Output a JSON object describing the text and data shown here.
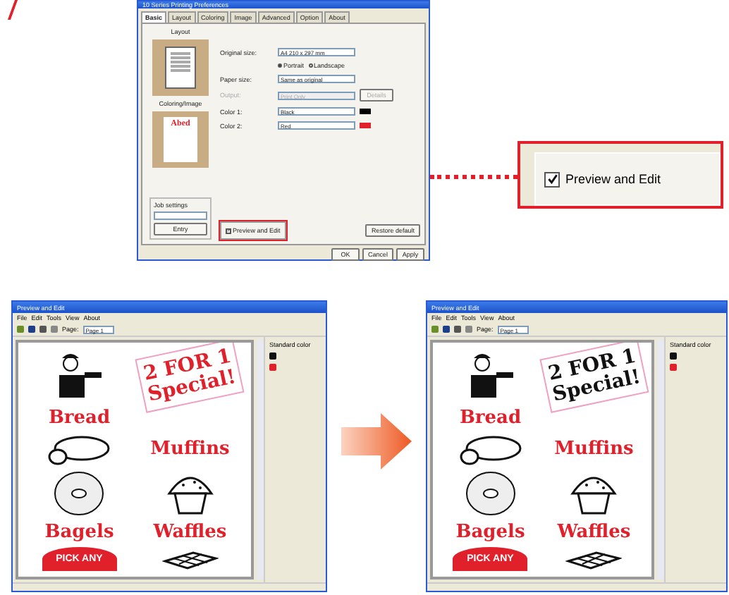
{
  "settings_dialog": {
    "title": "10 Series Printing Preferences",
    "tabs": [
      {
        "label": "Basic",
        "selected": true
      },
      {
        "label": "Layout",
        "selected": false
      },
      {
        "label": "Coloring",
        "selected": false
      },
      {
        "label": "Image",
        "selected": false
      },
      {
        "label": "Advanced",
        "selected": false
      },
      {
        "label": "Option",
        "selected": false
      },
      {
        "label": "About",
        "selected": false
      }
    ],
    "layout_label": "Layout",
    "original_size": {
      "label": "Original size:",
      "value": "A4 210 x 297 mm"
    },
    "orientation": [
      {
        "label": "Portrait",
        "selected": true
      },
      {
        "label": "Landscape",
        "selected": false
      }
    ],
    "paper_size": {
      "label": "Paper size:",
      "value": "Same as original"
    },
    "output": {
      "label": "Output:",
      "value": "Print Only",
      "disabled": true
    },
    "details_button": {
      "label": "Details",
      "disabled": true
    },
    "coloring_label": "Coloring/Image",
    "sample_text": "Abed",
    "colors": [
      {
        "label": "Color 1:",
        "value": "Black",
        "color": "#000000"
      },
      {
        "label": "Color 2:",
        "value": "Red",
        "color": "#e0202a"
      }
    ],
    "job_settings": {
      "label": "Job settings",
      "button": "Entry"
    },
    "preview_checkbox": {
      "label": "Preview and Edit",
      "checked": true
    },
    "restore_button": "Restore default",
    "buttons": [
      "OK",
      "Cancel",
      "Apply"
    ]
  },
  "callout": {
    "label": "Preview and Edit",
    "checked": true
  },
  "previews": [
    {
      "title": "Preview and Edit",
      "menu": [
        "File",
        "Edit",
        "Tools",
        "View",
        "About"
      ],
      "page_label": "Page:",
      "page_value": "Page 1",
      "side_label": "Standard color",
      "document": {
        "headline": [
          "2 FOR 1",
          "Special!"
        ],
        "color": "#e0202a",
        "items": [
          "Bread",
          "Muffins",
          "Bagels",
          "Waffles"
        ],
        "badge": "PICK ANY"
      }
    },
    {
      "title": "Preview and Edit",
      "menu": [
        "File",
        "Edit",
        "Tools",
        "View",
        "About"
      ],
      "page_label": "Page:",
      "page_value": "Page 1",
      "side_label": "Standard color",
      "document": {
        "headline": [
          "2 FOR 1",
          "Special!"
        ],
        "color": "#111111",
        "items": [
          "Bread",
          "Muffins",
          "Bagels",
          "Waffles"
        ],
        "badge": "PICK ANY"
      }
    }
  ]
}
